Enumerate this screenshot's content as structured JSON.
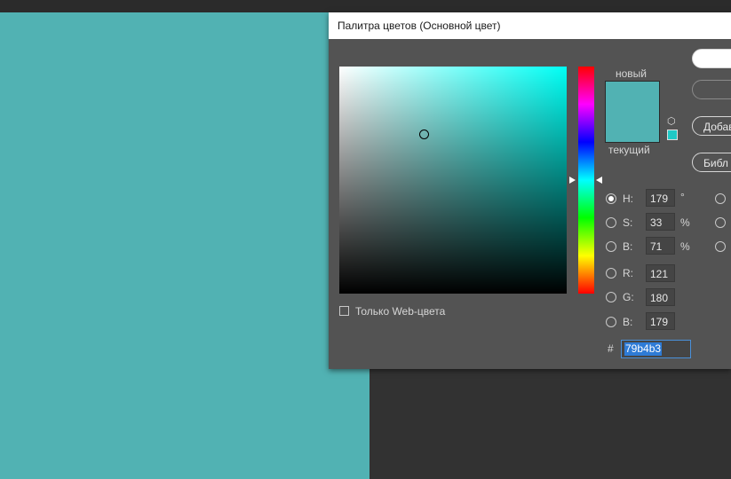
{
  "canvas": {
    "color": "#51b2b3"
  },
  "dialog": {
    "title": "Палитра цветов (Основной цвет)",
    "hue_color": "#00fff5",
    "preview": {
      "new_label": "новый",
      "current_label": "текущий",
      "new_color": "#51b2b3",
      "current_color": "#51b2b3",
      "icon": "cube-icon",
      "web_swatch_color": "#1fc9c6"
    },
    "buttons": {
      "ok": "",
      "cancel": "",
      "add": "Добав",
      "library": "Библ"
    },
    "web_only_label": "Только Web-цвета",
    "fields": {
      "h": {
        "label": "H:",
        "value": "179",
        "unit": "°"
      },
      "s": {
        "label": "S:",
        "value": "33",
        "unit": "%"
      },
      "b": {
        "label": "B:",
        "value": "71",
        "unit": "%"
      },
      "r": {
        "label": "R:",
        "value": "121"
      },
      "g": {
        "label": "G:",
        "value": "180"
      },
      "bb": {
        "label": "B:",
        "value": "179"
      }
    },
    "hex": {
      "symbol": "#",
      "value": "79b4b3"
    }
  }
}
